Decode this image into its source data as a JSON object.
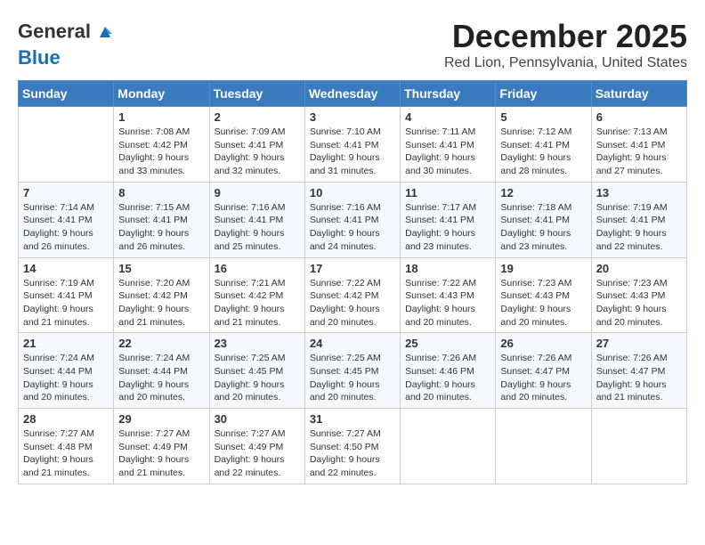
{
  "header": {
    "logo_line1": "General",
    "logo_line2": "Blue",
    "month_title": "December 2025",
    "location": "Red Lion, Pennsylvania, United States"
  },
  "weekdays": [
    "Sunday",
    "Monday",
    "Tuesday",
    "Wednesday",
    "Thursday",
    "Friday",
    "Saturday"
  ],
  "weeks": [
    [
      {
        "day": "",
        "sunrise": "",
        "sunset": "",
        "daylight": ""
      },
      {
        "day": "1",
        "sunrise": "7:08 AM",
        "sunset": "4:42 PM",
        "daylight": "9 hours and 33 minutes."
      },
      {
        "day": "2",
        "sunrise": "7:09 AM",
        "sunset": "4:41 PM",
        "daylight": "9 hours and 32 minutes."
      },
      {
        "day": "3",
        "sunrise": "7:10 AM",
        "sunset": "4:41 PM",
        "daylight": "9 hours and 31 minutes."
      },
      {
        "day": "4",
        "sunrise": "7:11 AM",
        "sunset": "4:41 PM",
        "daylight": "9 hours and 30 minutes."
      },
      {
        "day": "5",
        "sunrise": "7:12 AM",
        "sunset": "4:41 PM",
        "daylight": "9 hours and 28 minutes."
      },
      {
        "day": "6",
        "sunrise": "7:13 AM",
        "sunset": "4:41 PM",
        "daylight": "9 hours and 27 minutes."
      }
    ],
    [
      {
        "day": "7",
        "sunrise": "7:14 AM",
        "sunset": "4:41 PM",
        "daylight": "9 hours and 26 minutes."
      },
      {
        "day": "8",
        "sunrise": "7:15 AM",
        "sunset": "4:41 PM",
        "daylight": "9 hours and 26 minutes."
      },
      {
        "day": "9",
        "sunrise": "7:16 AM",
        "sunset": "4:41 PM",
        "daylight": "9 hours and 25 minutes."
      },
      {
        "day": "10",
        "sunrise": "7:16 AM",
        "sunset": "4:41 PM",
        "daylight": "9 hours and 24 minutes."
      },
      {
        "day": "11",
        "sunrise": "7:17 AM",
        "sunset": "4:41 PM",
        "daylight": "9 hours and 23 minutes."
      },
      {
        "day": "12",
        "sunrise": "7:18 AM",
        "sunset": "4:41 PM",
        "daylight": "9 hours and 23 minutes."
      },
      {
        "day": "13",
        "sunrise": "7:19 AM",
        "sunset": "4:41 PM",
        "daylight": "9 hours and 22 minutes."
      }
    ],
    [
      {
        "day": "14",
        "sunrise": "7:19 AM",
        "sunset": "4:41 PM",
        "daylight": "9 hours and 21 minutes."
      },
      {
        "day": "15",
        "sunrise": "7:20 AM",
        "sunset": "4:42 PM",
        "daylight": "9 hours and 21 minutes."
      },
      {
        "day": "16",
        "sunrise": "7:21 AM",
        "sunset": "4:42 PM",
        "daylight": "9 hours and 21 minutes."
      },
      {
        "day": "17",
        "sunrise": "7:22 AM",
        "sunset": "4:42 PM",
        "daylight": "9 hours and 20 minutes."
      },
      {
        "day": "18",
        "sunrise": "7:22 AM",
        "sunset": "4:43 PM",
        "daylight": "9 hours and 20 minutes."
      },
      {
        "day": "19",
        "sunrise": "7:23 AM",
        "sunset": "4:43 PM",
        "daylight": "9 hours and 20 minutes."
      },
      {
        "day": "20",
        "sunrise": "7:23 AM",
        "sunset": "4:43 PM",
        "daylight": "9 hours and 20 minutes."
      }
    ],
    [
      {
        "day": "21",
        "sunrise": "7:24 AM",
        "sunset": "4:44 PM",
        "daylight": "9 hours and 20 minutes."
      },
      {
        "day": "22",
        "sunrise": "7:24 AM",
        "sunset": "4:44 PM",
        "daylight": "9 hours and 20 minutes."
      },
      {
        "day": "23",
        "sunrise": "7:25 AM",
        "sunset": "4:45 PM",
        "daylight": "9 hours and 20 minutes."
      },
      {
        "day": "24",
        "sunrise": "7:25 AM",
        "sunset": "4:45 PM",
        "daylight": "9 hours and 20 minutes."
      },
      {
        "day": "25",
        "sunrise": "7:26 AM",
        "sunset": "4:46 PM",
        "daylight": "9 hours and 20 minutes."
      },
      {
        "day": "26",
        "sunrise": "7:26 AM",
        "sunset": "4:47 PM",
        "daylight": "9 hours and 20 minutes."
      },
      {
        "day": "27",
        "sunrise": "7:26 AM",
        "sunset": "4:47 PM",
        "daylight": "9 hours and 21 minutes."
      }
    ],
    [
      {
        "day": "28",
        "sunrise": "7:27 AM",
        "sunset": "4:48 PM",
        "daylight": "9 hours and 21 minutes."
      },
      {
        "day": "29",
        "sunrise": "7:27 AM",
        "sunset": "4:49 PM",
        "daylight": "9 hours and 21 minutes."
      },
      {
        "day": "30",
        "sunrise": "7:27 AM",
        "sunset": "4:49 PM",
        "daylight": "9 hours and 22 minutes."
      },
      {
        "day": "31",
        "sunrise": "7:27 AM",
        "sunset": "4:50 PM",
        "daylight": "9 hours and 22 minutes."
      },
      {
        "day": "",
        "sunrise": "",
        "sunset": "",
        "daylight": ""
      },
      {
        "day": "",
        "sunrise": "",
        "sunset": "",
        "daylight": ""
      },
      {
        "day": "",
        "sunrise": "",
        "sunset": "",
        "daylight": ""
      }
    ]
  ],
  "labels": {
    "sunrise": "Sunrise:",
    "sunset": "Sunset:",
    "daylight": "Daylight:"
  }
}
